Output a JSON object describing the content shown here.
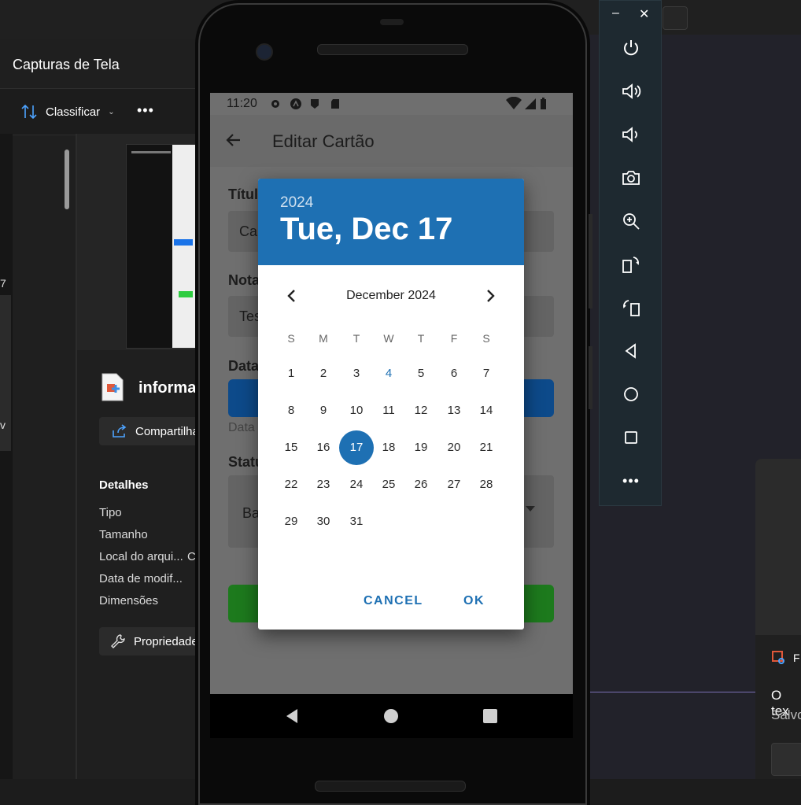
{
  "explorer": {
    "title": "Capturas de Tela",
    "sort_label": "Classificar",
    "more_label": "•••",
    "file_name": "informa",
    "share_label": "Compartilha",
    "details_title": "Detalhes",
    "detail_rows": [
      "Tipo",
      "Tamanho",
      "Local do arqui...",
      "Data de modif...",
      "Dimensões"
    ],
    "detail_value_cut": "C",
    "properties_label": "Propriedade",
    "left_cut_1": "7",
    "left_cut_2": "v"
  },
  "emulator": {
    "minimize": "–",
    "close": "✕",
    "tools": [
      "power-icon",
      "volume-up-icon",
      "volume-down-icon",
      "camera-icon",
      "zoom-icon",
      "rotate-left-icon",
      "rotate-right-icon",
      "back-icon",
      "home-icon",
      "overview-icon",
      "more-icon"
    ]
  },
  "phone": {
    "status_time": "11:20",
    "app_title": "Editar Cartão",
    "form": {
      "title_label": "Títul",
      "title_value": "Ca",
      "notes_label": "Nota",
      "notes_value": "Tes",
      "date_label": "Data",
      "date_hint": "Data",
      "status_label": "Statu",
      "status_value": "Ba"
    }
  },
  "date_picker": {
    "year": "2024",
    "selected_date": "Tue, Dec 17",
    "month_label": "December 2024",
    "weekdays": [
      "S",
      "M",
      "T",
      "W",
      "T",
      "F",
      "S"
    ],
    "days": [
      "1",
      "2",
      "3",
      "4",
      "5",
      "6",
      "7",
      "8",
      "9",
      "10",
      "11",
      "12",
      "13",
      "14",
      "15",
      "16",
      "17",
      "18",
      "19",
      "20",
      "21",
      "22",
      "23",
      "24",
      "25",
      "26",
      "27",
      "28",
      "29",
      "30",
      "31"
    ],
    "today": "4",
    "selected": "17",
    "cancel_label": "CANCEL",
    "ok_label": "OK",
    "accent": "#1e70b3"
  },
  "notification": {
    "app_initial": "F",
    "line1": "O tex",
    "line2": "Salvo"
  }
}
